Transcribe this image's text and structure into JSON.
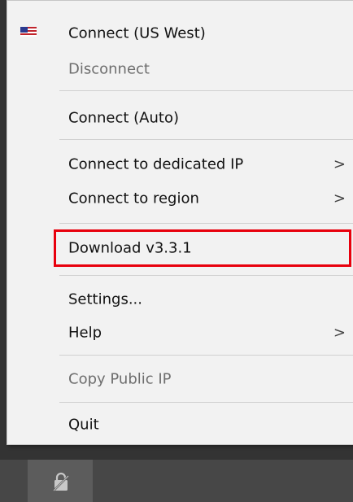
{
  "menu": {
    "items": [
      {
        "label": "Connect (US West)",
        "icon": "us-flag-icon",
        "enabled": true
      },
      {
        "label": "Disconnect",
        "enabled": false
      },
      {
        "label": "Connect (Auto)",
        "enabled": true
      },
      {
        "label": "Connect to dedicated IP",
        "submenu": true,
        "enabled": true
      },
      {
        "label": "Connect to region",
        "submenu": true,
        "enabled": true
      },
      {
        "label": "Download v3.3.1",
        "enabled": true,
        "highlighted": true
      },
      {
        "label": "Settings...",
        "enabled": true
      },
      {
        "label": "Help",
        "submenu": true,
        "enabled": true
      },
      {
        "label": "Copy Public IP",
        "enabled": false
      },
      {
        "label": "Quit",
        "enabled": true
      }
    ],
    "submenu_glyph": ">"
  },
  "colors": {
    "menu_background": "#f2f2f2",
    "highlight_border": "#e8000d",
    "disabled_text": "#6e6e6e",
    "taskbar": "#474747"
  },
  "taskbar": {
    "tray_icon": "vpn-lock-icon"
  }
}
